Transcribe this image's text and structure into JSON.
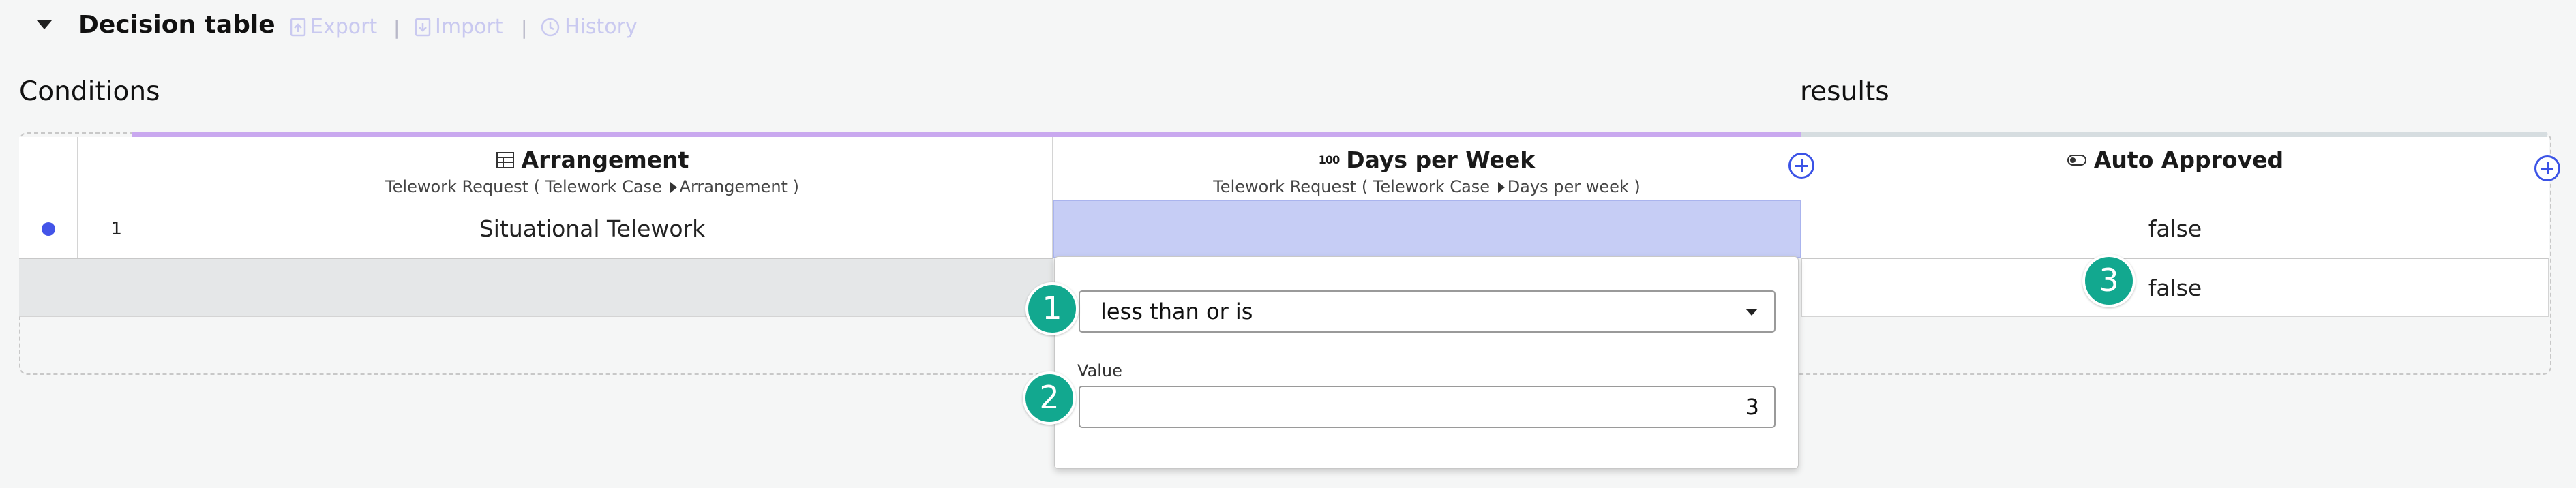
{
  "header": {
    "title": "Decision table",
    "export_label": "Export",
    "import_label": "Import",
    "history_label": "History",
    "separator": "|"
  },
  "sections": {
    "conditions": "Conditions",
    "results": "results"
  },
  "columns": [
    {
      "name": "Arrangement",
      "icon": "table-icon",
      "subtitle_prefix": "Telework Request ( Telework Case",
      "subtitle_field": "Arrangement )"
    },
    {
      "name": "Days per Week",
      "icon": "number-100-icon",
      "icon_text": "100",
      "subtitle_prefix": "Telework Request ( Telework Case",
      "subtitle_field": "Days per week )"
    },
    {
      "name": "Auto Approved",
      "icon": "toggle-icon"
    }
  ],
  "rows": [
    {
      "index": "1",
      "arrangement": "Situational Telework",
      "days": "",
      "auto_approved": "false"
    },
    {
      "index": "",
      "arrangement": "",
      "days": "",
      "auto_approved": "false"
    }
  ],
  "popup": {
    "operator": "less than or is",
    "value_label": "Value",
    "value": "3"
  },
  "badges": [
    "1",
    "2",
    "3"
  ],
  "colors": {
    "accent": "#3b53e6",
    "badge": "#12a88f",
    "selected_cell": "#c6cdf5",
    "conditions_bar": "#c9a8ef"
  }
}
